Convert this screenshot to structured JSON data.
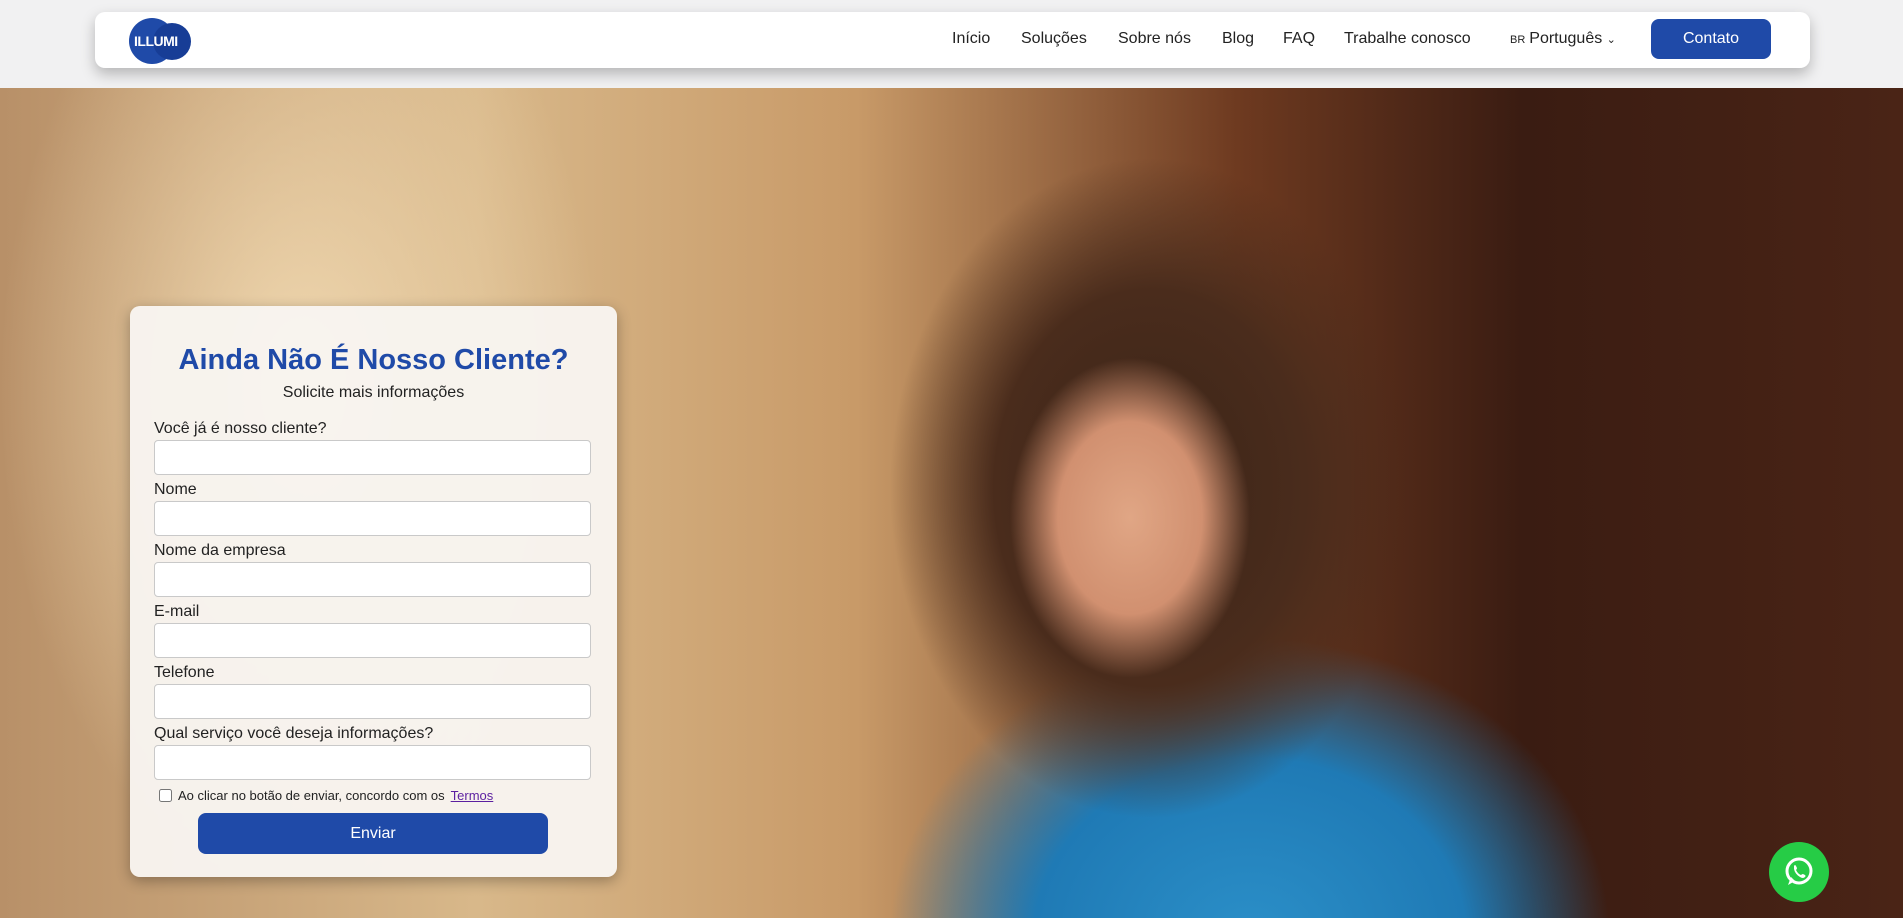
{
  "nav": {
    "logo": "ILLUMI",
    "items": [
      "Início",
      "Soluções",
      "Sobre nós",
      "Blog",
      "FAQ",
      "Trabalhe conosco"
    ],
    "lang_flag": "BR",
    "lang": "Português",
    "contact": "Contato"
  },
  "form": {
    "title": "Ainda Não É Nosso Cliente?",
    "subtitle": "Solicite mais informações",
    "fields": [
      {
        "label": "Você já é nosso cliente?",
        "value": ""
      },
      {
        "label": "Nome",
        "value": ""
      },
      {
        "label": "Nome da empresa",
        "value": ""
      },
      {
        "label": "E-mail",
        "value": ""
      },
      {
        "label": "Telefone",
        "value": ""
      },
      {
        "label": "Qual serviço você deseja informações?",
        "value": ""
      }
    ],
    "terms_text": "Ao clicar no botão de enviar, concordo com os",
    "terms_link": "Termos",
    "submit": "Enviar"
  },
  "colors": {
    "brand": "#1f4aa8",
    "whatsapp": "#26cc46"
  }
}
